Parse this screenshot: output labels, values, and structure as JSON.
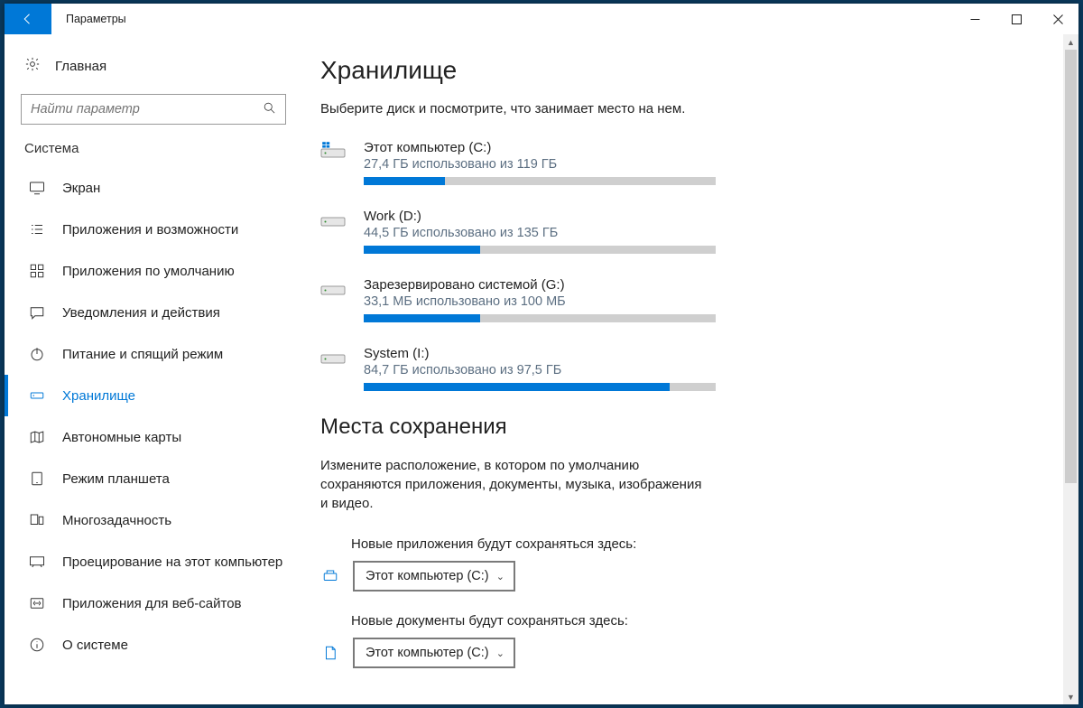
{
  "window": {
    "title": "Параметры"
  },
  "sidebar": {
    "home": "Главная",
    "search_placeholder": "Найти параметр",
    "section": "Система",
    "items": [
      {
        "label": "Экран"
      },
      {
        "label": "Приложения и возможности"
      },
      {
        "label": "Приложения по умолчанию"
      },
      {
        "label": "Уведомления и действия"
      },
      {
        "label": "Питание и спящий режим"
      },
      {
        "label": "Хранилище"
      },
      {
        "label": "Автономные карты"
      },
      {
        "label": "Режим планшета"
      },
      {
        "label": "Многозадачность"
      },
      {
        "label": "Проецирование на этот компьютер"
      },
      {
        "label": "Приложения для веб-сайтов"
      },
      {
        "label": "О системе"
      }
    ]
  },
  "page": {
    "title": "Хранилище",
    "subtitle": "Выберите диск и посмотрите, что занимает место на нем.",
    "drives": [
      {
        "name": "Этот компьютер (C:)",
        "usage": "27,4 ГБ использовано из 119 ГБ",
        "percent": 23,
        "system": true
      },
      {
        "name": "Work (D:)",
        "usage": "44,5 ГБ использовано из 135 ГБ",
        "percent": 33,
        "system": false
      },
      {
        "name": "Зарезервировано системой (G:)",
        "usage": "33,1 МБ использовано из 100 МБ",
        "percent": 33,
        "system": false
      },
      {
        "name": "System (I:)",
        "usage": "84,7 ГБ использовано из 97,5 ГБ",
        "percent": 87,
        "system": false
      }
    ],
    "save_section": {
      "title": "Места сохранения",
      "description": "Измените расположение, в котором по умолчанию сохраняются приложения, документы, музыка, изображения и видео.",
      "rows": [
        {
          "label": "Новые приложения будут сохраняться здесь:",
          "value": "Этот компьютер (C:)"
        },
        {
          "label": "Новые документы будут сохраняться здесь:",
          "value": "Этот компьютер (C:)"
        }
      ]
    }
  }
}
